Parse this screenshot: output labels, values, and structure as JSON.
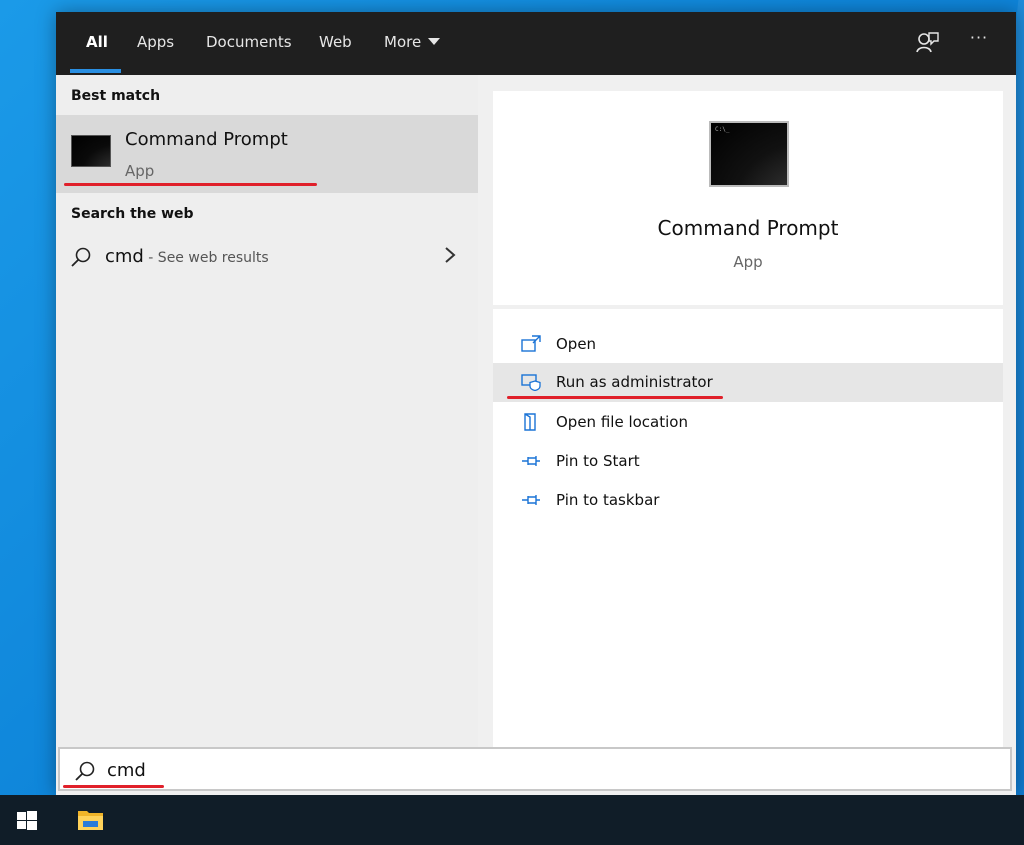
{
  "tabs": [
    {
      "label": "All",
      "active": true
    },
    {
      "label": "Apps"
    },
    {
      "label": "Documents"
    },
    {
      "label": "Web"
    },
    {
      "label": "More"
    }
  ],
  "topbar_icons": [
    "feedback-icon",
    "more-options-icon"
  ],
  "more_options_label": "···",
  "left": {
    "best_match_label": "Best match",
    "best_match": {
      "title": "Command Prompt",
      "subtitle": "App",
      "icon": "command-prompt-icon"
    },
    "search_web_label": "Search the web",
    "web_result": {
      "query": "cmd",
      "hint": " - See web results"
    }
  },
  "right": {
    "title": "Command Prompt",
    "subtitle": "App",
    "thumb_text": "C:\\_",
    "actions": [
      {
        "label": "Open",
        "icon": "open-icon"
      },
      {
        "label": "Run as administrator",
        "icon": "run-as-admin-icon",
        "highlighted": true
      },
      {
        "label": "Open file location",
        "icon": "file-location-icon"
      },
      {
        "label": "Pin to Start",
        "icon": "pin-icon"
      },
      {
        "label": "Pin to taskbar",
        "icon": "pin-icon"
      }
    ]
  },
  "search": {
    "value": "cmd"
  },
  "colors": {
    "accent": "#2a8fe2",
    "annotation": "#e0202a",
    "topbar": "#1f1f1f",
    "taskbar": "#101d28"
  },
  "taskbar_icons": [
    "windows-start-icon",
    "file-explorer-icon"
  ]
}
